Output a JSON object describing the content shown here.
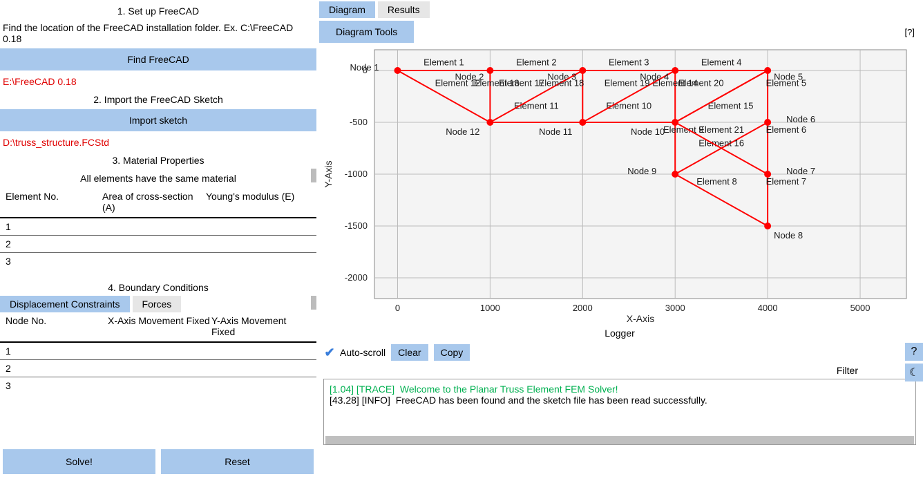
{
  "left": {
    "step1_title": "1. Set up FreeCAD",
    "step1_text": "Find the location of the FreeCAD installation folder. Ex. C:\\FreeCAD 0.18",
    "find_button": "Find FreeCAD",
    "freecad_path": "E:\\FreeCAD 0.18",
    "step2_title": "2. Import the FreeCAD Sketch",
    "import_button": "Import sketch",
    "sketch_path": "D:\\truss_structure.FCStd",
    "step3_title": "3. Material Properties",
    "mat_note": "All elements have the same material",
    "mat_headers": {
      "c1": "Element No.",
      "c2": "Area of cross-section (A)",
      "c3": "Young's modulus (E)"
    },
    "mat_rows": [
      "1",
      "2",
      "3"
    ],
    "step4_title": "4. Boundary Conditions",
    "bc_tabs": {
      "disp": "Displacement Constraints",
      "forces": "Forces"
    },
    "bc_headers": {
      "c1": "Node No.",
      "c2": "X-Axis Movement Fixed",
      "c3": "Y-Axis Movement Fixed"
    },
    "bc_rows": [
      "1",
      "2",
      "3"
    ],
    "solve": "Solve!",
    "reset": "Reset"
  },
  "right": {
    "tabs": {
      "diagram": "Diagram",
      "results": "Results"
    },
    "diagram_tools": "Diagram Tools",
    "help": "[?]",
    "chart": {
      "xlabel": "X-Axis",
      "ylabel": "Y-Axis",
      "xticks": [
        0,
        1000,
        2000,
        3000,
        4000,
        5000
      ],
      "yticks": [
        0,
        -500,
        -1000,
        -1500,
        -2000
      ]
    },
    "logger_title": "Logger",
    "auto_scroll": "Auto-scroll",
    "clear": "Clear",
    "copy": "Copy",
    "filter": "Filter",
    "log_lines": [
      {
        "cls": "log-trace",
        "text": "[1.04] [TRACE]  Welcome to the Planar Truss Element FEM Solver!"
      },
      {
        "cls": "",
        "text": "[43.28] [INFO]  FreeCAD has been found and the sketch file has been read successfully."
      }
    ],
    "side_icons": {
      "help": "?",
      "dark": "☾"
    }
  },
  "chart_data": {
    "type": "diagram",
    "title": "",
    "xlabel": "X-Axis",
    "ylabel": "Y-Axis",
    "xlim": [
      -250,
      5500
    ],
    "ylim": [
      -2200,
      200
    ],
    "nodes": [
      {
        "id": 1,
        "label": "Node 1",
        "x": 0,
        "y": 0
      },
      {
        "id": 2,
        "label": "Node 2",
        "x": 1000,
        "y": 0
      },
      {
        "id": 3,
        "label": "Node 3",
        "x": 2000,
        "y": 0
      },
      {
        "id": 4,
        "label": "Node 4",
        "x": 3000,
        "y": 0
      },
      {
        "id": 5,
        "label": "Node 5",
        "x": 4000,
        "y": 0
      },
      {
        "id": 6,
        "label": "Node 6",
        "x": 4000,
        "y": -500
      },
      {
        "id": 7,
        "label": "Node 7",
        "x": 4000,
        "y": -1000
      },
      {
        "id": 8,
        "label": "Node 8",
        "x": 4000,
        "y": -1500
      },
      {
        "id": 9,
        "label": "Node 9",
        "x": 3000,
        "y": -1000
      },
      {
        "id": 10,
        "label": "Node 10",
        "x": 3000,
        "y": -500
      },
      {
        "id": 11,
        "label": "Node 11",
        "x": 2000,
        "y": -500
      },
      {
        "id": 12,
        "label": "Node 12",
        "x": 1000,
        "y": -500
      }
    ],
    "elements": [
      {
        "id": 1,
        "label": "Element 1",
        "n1": 1,
        "n2": 2
      },
      {
        "id": 2,
        "label": "Element 2",
        "n1": 2,
        "n2": 3
      },
      {
        "id": 3,
        "label": "Element 3",
        "n1": 3,
        "n2": 4
      },
      {
        "id": 4,
        "label": "Element 4",
        "n1": 4,
        "n2": 5
      },
      {
        "id": 5,
        "label": "Element 5",
        "n1": 5,
        "n2": 6
      },
      {
        "id": 6,
        "label": "Element 6",
        "n1": 6,
        "n2": 7
      },
      {
        "id": 7,
        "label": "Element 7",
        "n1": 7,
        "n2": 8
      },
      {
        "id": 8,
        "label": "Element 8",
        "n1": 9,
        "n2": 8
      },
      {
        "id": 9,
        "label": "Element 9",
        "n1": 10,
        "n2": 9
      },
      {
        "id": 10,
        "label": "Element 10",
        "n1": 11,
        "n2": 10
      },
      {
        "id": 11,
        "label": "Element 11",
        "n1": 12,
        "n2": 11
      },
      {
        "id": 12,
        "label": "Element 12",
        "n1": 1,
        "n2": 12
      },
      {
        "id": 13,
        "label": "Element 13",
        "n1": 2,
        "n2": 12
      },
      {
        "id": 14,
        "label": "Element 14",
        "n1": 4,
        "n2": 10
      },
      {
        "id": 15,
        "label": "Element 15",
        "n1": 5,
        "n2": 10
      },
      {
        "id": 16,
        "label": "Element 16",
        "n1": 6,
        "n2": 9
      },
      {
        "id": 17,
        "label": "Element 17",
        "n1": 12,
        "n2": 3
      },
      {
        "id": 18,
        "label": "Element 18",
        "n1": 3,
        "n2": 11
      },
      {
        "id": 19,
        "label": "Element 19",
        "n1": 11,
        "n2": 4
      },
      {
        "id": 20,
        "label": "Element 20",
        "n1": 10,
        "n2": 5
      },
      {
        "id": 21,
        "label": "Element 21",
        "n1": 10,
        "n2": 7
      }
    ]
  }
}
